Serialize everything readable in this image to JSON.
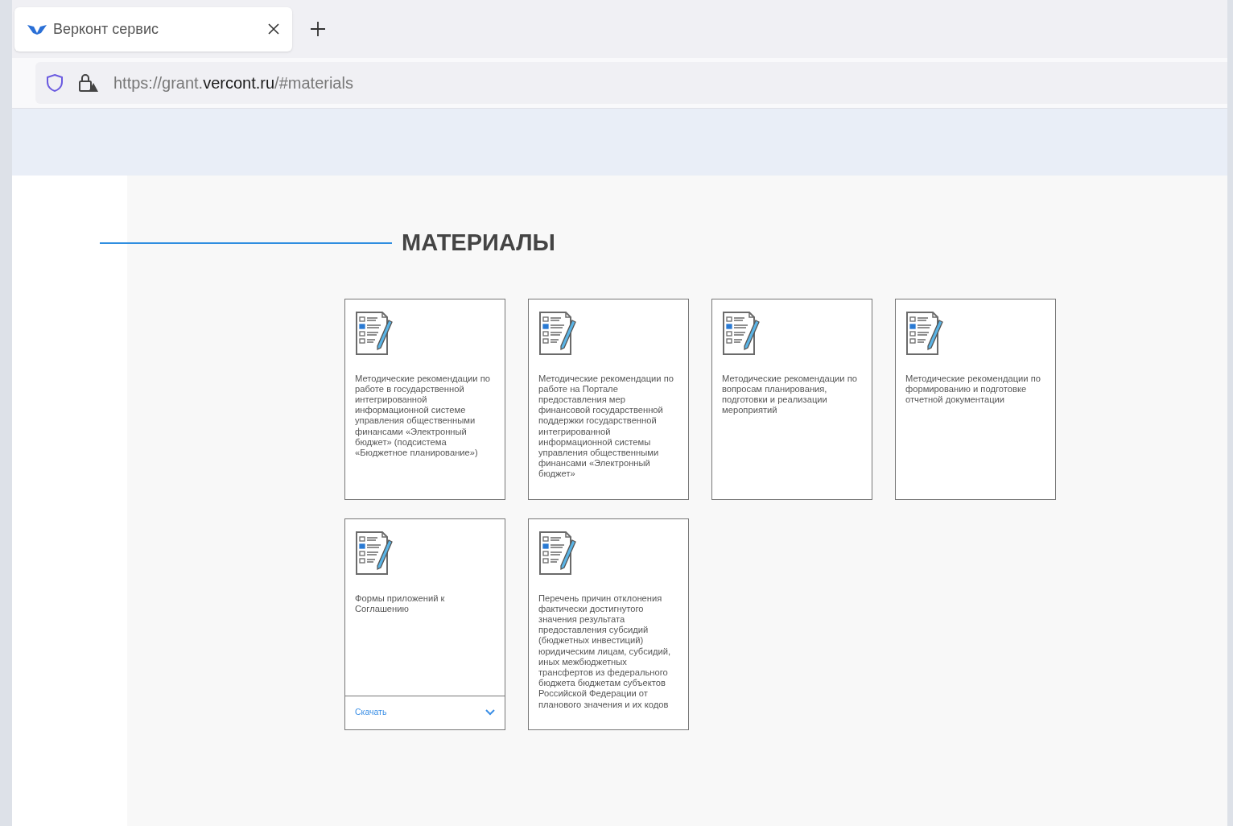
{
  "browser": {
    "tab": {
      "title": "Верконт сервис",
      "selected": true
    },
    "url": {
      "prefix": "https://grant.",
      "domain": "vercont.ru",
      "path": "/#materials"
    }
  },
  "page": {
    "heading": "МАТЕРИАЛЫ",
    "cards": [
      {
        "title": "Методические рекомендации по работе в государственной интегрированной информационной системе управления общественными финансами «Электронный бюджет» (подсистема «Бюджетное планирование»)"
      },
      {
        "title": "Методические рекомендации по работе на Портале предоставления мер финансовой государственной поддержки государственной интегрированной информационной системы управления общественными финансами «Электронный бюджет»"
      },
      {
        "title": "Методические рекомендации по вопросам планирования, подготовки и реализации мероприятий"
      },
      {
        "title": "Методические рекомендации по формированию и подготовке отчетной документации"
      },
      {
        "title": "Формы приложений к Соглашению",
        "download": "Скачать"
      },
      {
        "title": "Перечень причин отклонения фактически достигнутого значения результата предоставления субсидий (бюджетных инвестиций) юридическим лицам, субсидий, иных межбюджетных трансфертов из федерального бюджета бюджетам субъектов Российской Федерации от планового значения и их кодов"
      }
    ]
  }
}
